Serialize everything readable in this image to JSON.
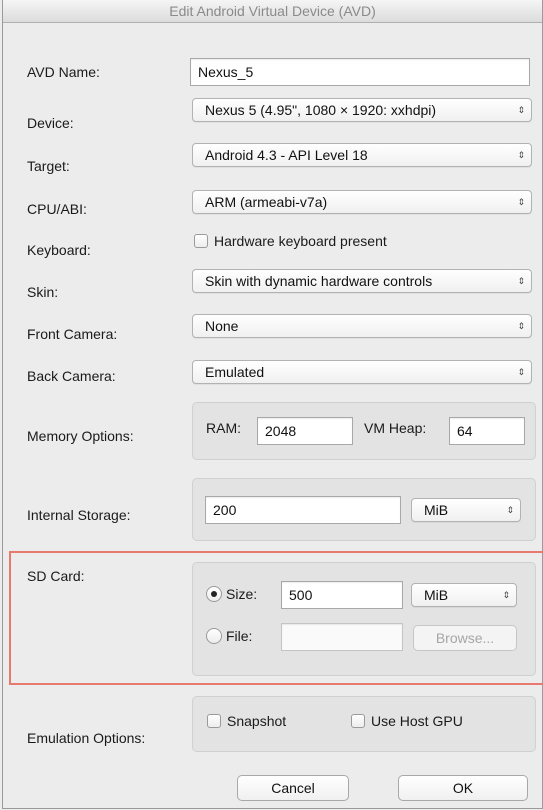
{
  "window": {
    "title": "Edit Android Virtual Device (AVD)"
  },
  "form": {
    "avd_name": {
      "label": "AVD Name:",
      "value": "Nexus_5"
    },
    "device": {
      "label": "Device:",
      "value": "Nexus 5 (4.95\", 1080 × 1920: xxhdpi)"
    },
    "target": {
      "label": "Target:",
      "value": "Android 4.3 - API Level 18"
    },
    "cpu_abi": {
      "label": "CPU/ABI:",
      "value": "ARM (armeabi-v7a)"
    },
    "keyboard": {
      "label": "Keyboard:",
      "checkbox_label": "Hardware keyboard present",
      "checked": false
    },
    "skin": {
      "label": "Skin:",
      "value": "Skin with dynamic hardware controls"
    },
    "front_camera": {
      "label": "Front Camera:",
      "value": "None"
    },
    "back_camera": {
      "label": "Back Camera:",
      "value": "Emulated"
    },
    "memory": {
      "label": "Memory Options:",
      "ram_label": "RAM:",
      "ram_value": "2048",
      "vm_heap_label": "VM Heap:",
      "vm_heap_value": "64"
    },
    "internal_storage": {
      "label": "Internal Storage:",
      "value": "200",
      "unit": "MiB"
    },
    "sd_card": {
      "label": "SD Card:",
      "size_label": "Size:",
      "size_value": "500",
      "size_unit": "MiB",
      "size_selected": true,
      "file_label": "File:",
      "file_value": "",
      "browse_label": "Browse..."
    },
    "emulation": {
      "label": "Emulation Options:",
      "snapshot_label": "Snapshot",
      "snapshot_checked": false,
      "host_gpu_label": "Use Host GPU",
      "host_gpu_checked": false
    }
  },
  "buttons": {
    "cancel": "Cancel",
    "ok": "OK"
  },
  "colors": {
    "highlight": "#e8796e"
  }
}
